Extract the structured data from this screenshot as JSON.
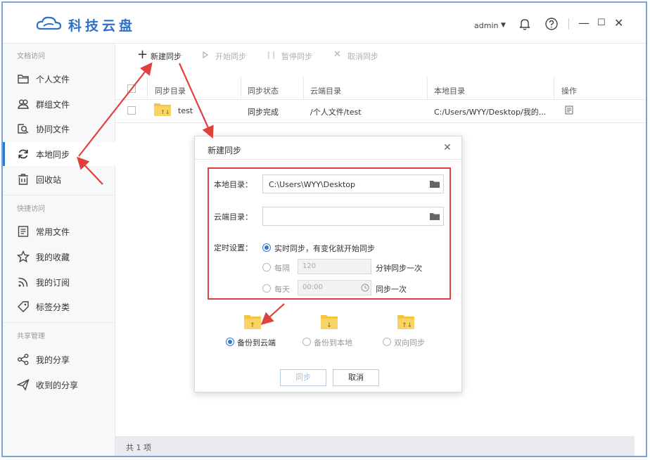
{
  "app": {
    "title": "科技云盘",
    "user": "admin"
  },
  "sidebar": {
    "sections": [
      {
        "title": "文档访问",
        "items": [
          {
            "label": "个人文件",
            "icon": "folder-icon"
          },
          {
            "label": "群组文件",
            "icon": "group-icon"
          },
          {
            "label": "协同文件",
            "icon": "collaborate-icon"
          },
          {
            "label": "本地同步",
            "icon": "sync-icon",
            "active": true
          },
          {
            "label": "回收站",
            "icon": "trash-icon"
          }
        ]
      },
      {
        "title": "快捷访问",
        "items": [
          {
            "label": "常用文件",
            "icon": "document-icon"
          },
          {
            "label": "我的收藏",
            "icon": "star-icon"
          },
          {
            "label": "我的订阅",
            "icon": "rss-icon"
          },
          {
            "label": "标签分类",
            "icon": "tag-icon"
          }
        ]
      },
      {
        "title": "共享管理",
        "items": [
          {
            "label": "我的分享",
            "icon": "share-icon"
          },
          {
            "label": "收到的分享",
            "icon": "send-icon"
          }
        ]
      }
    ]
  },
  "toolbar": {
    "new_sync": "新建同步",
    "start_sync": "开始同步",
    "pause_sync": "暂停同步",
    "cancel_sync": "取消同步"
  },
  "table": {
    "columns": [
      "同步目录",
      "同步状态",
      "云端目录",
      "本地目录",
      "操作"
    ],
    "rows": [
      {
        "name": "test",
        "status": "同步完成",
        "cloud_dir": "/个人文件/test",
        "local_dir": "C:/Users/WYY/Desktop/我的..."
      }
    ]
  },
  "status_bar": {
    "count_text": "共 1 项"
  },
  "dialog": {
    "title": "新建同步",
    "local_dir_label": "本地目录：",
    "local_dir_value": "C:\\Users\\WYY\\Desktop",
    "cloud_dir_label": "云端目录：",
    "cloud_dir_value": "",
    "schedule_label": "定时设置：",
    "realtime_option": "实时同步，有变化就开始同步",
    "every_option": "每隔",
    "every_value": "120",
    "every_suffix": "分钟同步一次",
    "daily_option": "每天",
    "daily_value": "00:00",
    "daily_suffix": "同步一次",
    "modes": [
      {
        "label": "备份到云端",
        "selected": true
      },
      {
        "label": "备份到本地",
        "selected": false
      },
      {
        "label": "双向同步",
        "selected": false
      }
    ],
    "sync_button": "同步",
    "cancel_button": "取消"
  },
  "colors": {
    "brand": "#2f71c4",
    "accent": "#2f78d0",
    "annotation": "#e0413e",
    "folder": "#f5c542"
  }
}
